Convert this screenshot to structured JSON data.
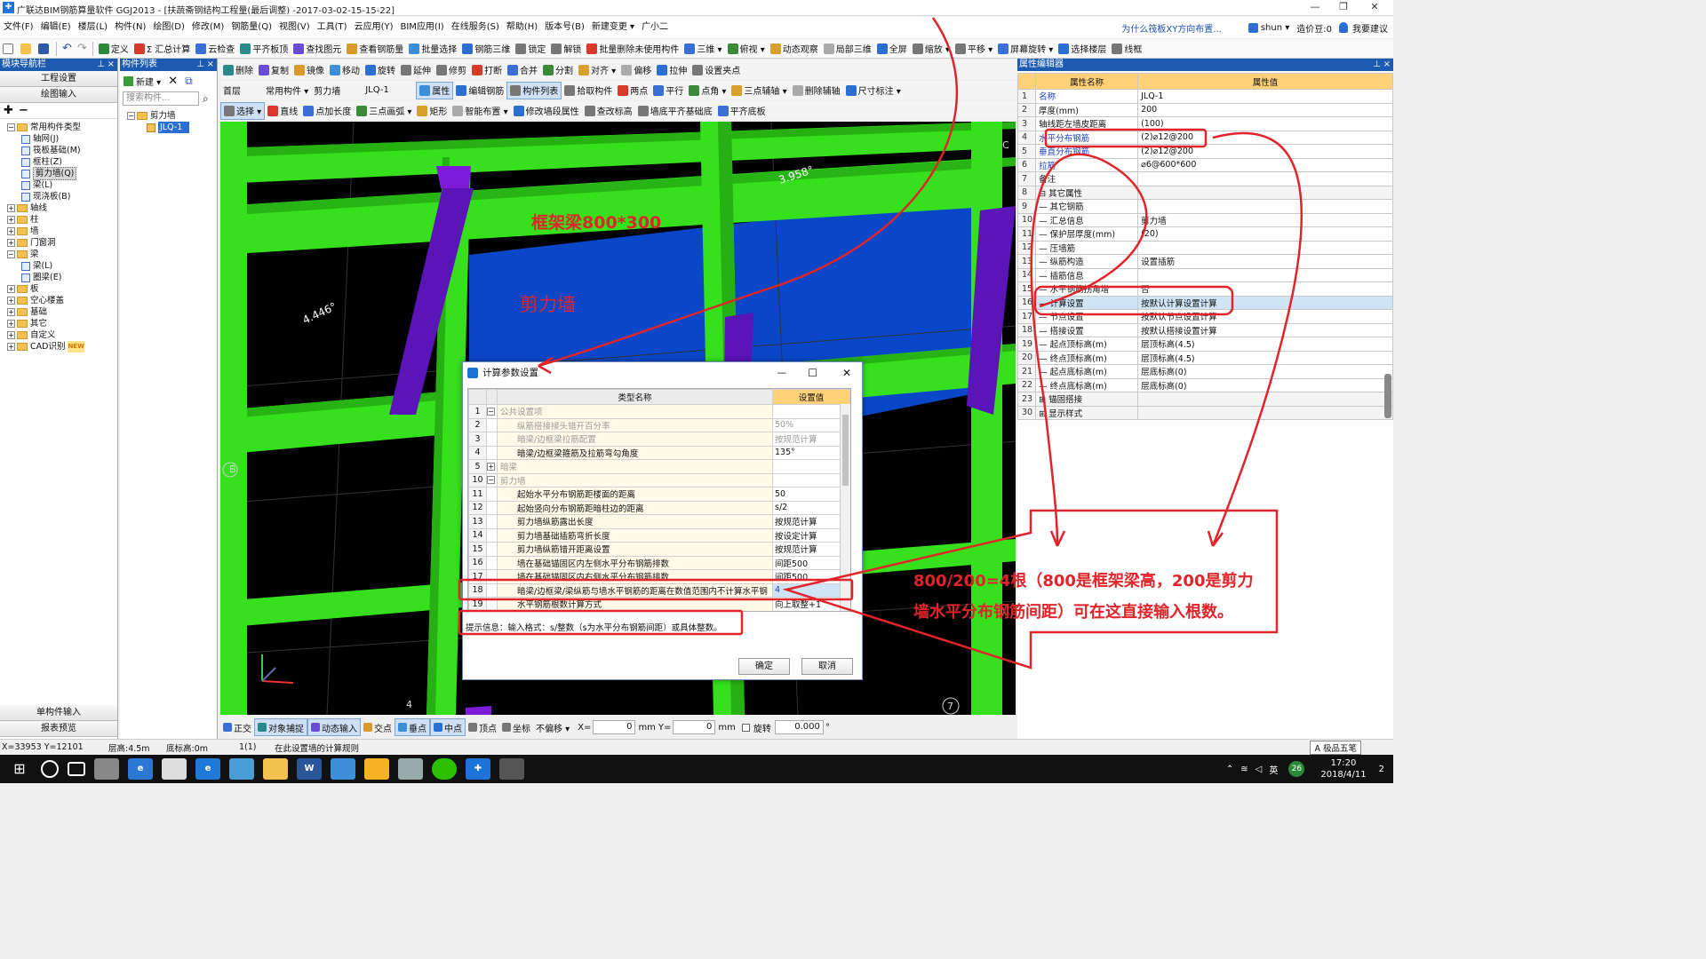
{
  "titlebar": {
    "title": "广联达BIM钢筋算量软件 GGJ2013 - [扶蔬斋钢结构工程量(最后调整) -2017-03-02-15-15-22]",
    "minimize": "—",
    "restore": "❐",
    "close": "✕"
  },
  "menu": {
    "items": [
      "文件(F)",
      "编辑(E)",
      "楼层(L)",
      "构件(N)",
      "绘图(D)",
      "修改(M)",
      "钢筋量(Q)",
      "视图(V)",
      "工具(T)",
      "云应用(Y)",
      "BIM应用(I)",
      "在线服务(S)",
      "帮助(H)",
      "版本号(B)",
      "新建变更 ▾",
      "广小二"
    ],
    "right_link": "为什么筏板XY方向布置...",
    "user": "shun ▾",
    "cost": "造价豆:0",
    "wish": "我要建议"
  },
  "toolbar1": {
    "items": [
      "定义",
      "Σ 汇总计算",
      "云检查",
      "平齐板顶",
      "查找图元",
      "查看钢筋量",
      "批量选择",
      "钢筋三维",
      "锁定",
      "解锁",
      "批量删除未使用构件",
      "三维 ▾",
      "俯视 ▾",
      "动态观察",
      "局部三维",
      "全屏",
      "缩放 ▾",
      "平移 ▾",
      "屏幕旋转 ▾",
      "选择楼层",
      "线框"
    ]
  },
  "toolbar2": {
    "items": [
      "删除",
      "复制",
      "镜像",
      "移动",
      "旋转",
      "延伸",
      "修剪",
      "打断",
      "合并",
      "分割",
      "对齐 ▾",
      "偏移",
      "拉伸",
      "设置夹点"
    ]
  },
  "toolbar3": {
    "floor": "首层",
    "category": "常用构件 ▾",
    "type": "剪力墙",
    "element": "JLQ-1",
    "items": [
      "属性",
      "编辑钢筋",
      "构件列表",
      "拾取构件",
      "两点",
      "平行",
      "点角 ▾",
      "三点辅轴 ▾",
      "删除辅轴",
      "尺寸标注 ▾"
    ]
  },
  "toolbar4": {
    "items": [
      "选择 ▾",
      "直线",
      "点加长度",
      "三点画弧 ▾",
      "矩形",
      "智能布置 ▾",
      "修改墙段属性",
      "查改标高",
      "墙底平齐基础底",
      "平齐底板"
    ]
  },
  "nav": {
    "title": "模块导航栏",
    "btn1": "工程设置",
    "btn2": "绘图输入",
    "tree": [
      {
        "level": 0,
        "exp": "−",
        "label": "常用构件类型",
        "icon": "folder"
      },
      {
        "level": 1,
        "label": "轴网(J)",
        "icon": "comp"
      },
      {
        "level": 1,
        "label": "筏板基础(M)",
        "icon": "comp"
      },
      {
        "level": 1,
        "label": "框柱(Z)",
        "icon": "comp"
      },
      {
        "level": 1,
        "label": "剪力墙(Q)",
        "icon": "comp",
        "selected": true
      },
      {
        "level": 1,
        "label": "梁(L)",
        "icon": "comp"
      },
      {
        "level": 1,
        "label": "现浇板(B)",
        "icon": "comp"
      },
      {
        "level": 0,
        "exp": "+",
        "label": "轴线",
        "icon": "folder"
      },
      {
        "level": 0,
        "exp": "+",
        "label": "柱",
        "icon": "folder"
      },
      {
        "level": 0,
        "exp": "+",
        "label": "墙",
        "icon": "folder"
      },
      {
        "level": 0,
        "exp": "+",
        "label": "门窗洞",
        "icon": "folder"
      },
      {
        "level": 0,
        "exp": "−",
        "label": "梁",
        "icon": "folder"
      },
      {
        "level": 1,
        "label": "梁(L)",
        "icon": "comp"
      },
      {
        "level": 1,
        "label": "圈梁(E)",
        "icon": "comp"
      },
      {
        "level": 0,
        "exp": "+",
        "label": "板",
        "icon": "folder"
      },
      {
        "level": 0,
        "exp": "+",
        "label": "空心楼盖",
        "icon": "folder"
      },
      {
        "level": 0,
        "exp": "+",
        "label": "基础",
        "icon": "folder"
      },
      {
        "level": 0,
        "exp": "+",
        "label": "其它",
        "icon": "folder"
      },
      {
        "level": 0,
        "exp": "+",
        "label": "自定义",
        "icon": "folder"
      },
      {
        "level": 0,
        "exp": "+",
        "label": "CAD识别",
        "icon": "folder",
        "badge": "NEW"
      }
    ],
    "bottom1": "单构件输入",
    "bottom2": "报表预览"
  },
  "complist": {
    "title": "构件列表",
    "new_btn": "新建 ▾",
    "search_placeholder": "搜索构件...",
    "group": "剪力墙",
    "item": "JLQ-1"
  },
  "viewport": {
    "angle1": "3.958°",
    "angle2": "4.446°",
    "axis_b1": "B",
    "axis_b2": "B",
    "axis_4": "4",
    "axis_7": "7",
    "axis_c": "C"
  },
  "props": {
    "title": "属性编辑器",
    "col_name": "属性名称",
    "col_value": "属性值",
    "rows": [
      {
        "n": "1",
        "name": "名称",
        "value": "JLQ-1",
        "blue": true
      },
      {
        "n": "2",
        "name": "厚度(mm)",
        "value": "200",
        "blue": false
      },
      {
        "n": "3",
        "name": "轴线距左墙皮距离",
        "value": "(100)",
        "blue": false
      },
      {
        "n": "4",
        "name": "水平分布钢筋",
        "value": "(2)⌀12@200",
        "blue": true
      },
      {
        "n": "5",
        "name": "垂直分布钢筋",
        "value": "(2)⌀12@200",
        "blue": true
      },
      {
        "n": "6",
        "name": "拉筋",
        "value": "⌀6@600*600",
        "blue": true
      },
      {
        "n": "7",
        "name": "备注",
        "value": "",
        "blue": false
      },
      {
        "n": "8",
        "name": "⊟ 其它属性",
        "value": "",
        "blue": false,
        "group": true
      },
      {
        "n": "9",
        "name": "— 其它钢筋",
        "value": "",
        "blue": false
      },
      {
        "n": "10",
        "name": "— 汇总信息",
        "value": "剪力墙",
        "blue": false
      },
      {
        "n": "11",
        "name": "— 保护层厚度(mm)",
        "value": "(20)",
        "blue": false
      },
      {
        "n": "12",
        "name": "— 压墙筋",
        "value": "",
        "blue": false
      },
      {
        "n": "13",
        "name": "— 纵筋构造",
        "value": "设置插筋",
        "blue": false
      },
      {
        "n": "14",
        "name": "— 插筋信息",
        "value": "",
        "blue": false
      },
      {
        "n": "15",
        "name": "— 水平钢筋拐角增",
        "value": "否",
        "blue": false
      },
      {
        "n": "16",
        "name": "— 计算设置",
        "value": "按默认计算设置计算",
        "blue": false,
        "sel": true
      },
      {
        "n": "17",
        "name": "— 节点设置",
        "value": "按默认节点设置计算",
        "blue": false
      },
      {
        "n": "18",
        "name": "— 搭接设置",
        "value": "按默认搭接设置计算",
        "blue": false
      },
      {
        "n": "19",
        "name": "— 起点顶标高(m)",
        "value": "层顶标高(4.5)",
        "blue": false
      },
      {
        "n": "20",
        "name": "— 终点顶标高(m)",
        "value": "层顶标高(4.5)",
        "blue": false
      },
      {
        "n": "21",
        "name": "— 起点底标高(m)",
        "value": "层底标高(0)",
        "blue": false
      },
      {
        "n": "22",
        "name": "— 终点底标高(m)",
        "value": "层底标高(0)",
        "blue": false
      },
      {
        "n": "23",
        "name": "⊞ 锚固搭接",
        "value": "",
        "blue": false,
        "group": true
      },
      {
        "n": "30",
        "name": "⊞ 显示样式",
        "value": "",
        "blue": false,
        "group": true
      }
    ]
  },
  "dialog": {
    "title": "计算参数设置",
    "col_type": "类型名称",
    "col_value": "设置值",
    "rows": [
      {
        "n": "1",
        "e": "−",
        "name": "公共设置项",
        "value": "",
        "grey": true,
        "indent": 0
      },
      {
        "n": "2",
        "e": "",
        "name": "纵筋搭接接头错开百分率",
        "value": "50%",
        "grey": true,
        "indent": 1
      },
      {
        "n": "3",
        "e": "",
        "name": "暗梁/边框梁拉筋配置",
        "value": "按规范计算",
        "grey": true,
        "indent": 1
      },
      {
        "n": "4",
        "e": "",
        "name": "暗梁/边框梁箍筋及拉筋弯勾角度",
        "value": "135°",
        "grey": false,
        "indent": 1
      },
      {
        "n": "5",
        "e": "+",
        "name": "暗梁",
        "value": "",
        "grey": true,
        "indent": 0
      },
      {
        "n": "10",
        "e": "−",
        "name": "剪力墙",
        "value": "",
        "grey": true,
        "indent": 0
      },
      {
        "n": "11",
        "e": "",
        "name": "起始水平分布钢筋距楼面的距离",
        "value": "50",
        "grey": false,
        "indent": 1
      },
      {
        "n": "12",
        "e": "",
        "name": "起始竖向分布钢筋距暗柱边的距离",
        "value": "s/2",
        "grey": false,
        "indent": 1
      },
      {
        "n": "13",
        "e": "",
        "name": "剪力墙纵筋露出长度",
        "value": "按规范计算",
        "grey": false,
        "indent": 1
      },
      {
        "n": "14",
        "e": "",
        "name": "剪力墙基础插筋弯折长度",
        "value": "按设定计算",
        "grey": false,
        "indent": 1
      },
      {
        "n": "15",
        "e": "",
        "name": "剪力墙纵筋错开距离设置",
        "value": "按规范计算",
        "grey": false,
        "indent": 1
      },
      {
        "n": "16",
        "e": "",
        "name": "墙在基础锚固区内左侧水平分布钢筋排数",
        "value": "间距500",
        "grey": false,
        "indent": 1
      },
      {
        "n": "17",
        "e": "",
        "name": "墙在基础锚固区内右侧水平分布钢筋排数",
        "value": "间距500",
        "grey": false,
        "indent": 1
      },
      {
        "n": "18",
        "e": "",
        "name": "暗梁/边框梁/梁纵筋与墙水平钢筋的距离在数值范围内不计算水平钢",
        "value": "4",
        "grey": false,
        "indent": 1,
        "sel": true
      },
      {
        "n": "19",
        "e": "",
        "name": "水平钢筋根数计算方式",
        "value": "向上取整+1",
        "grey": false,
        "indent": 1
      }
    ],
    "hint": "提示信息：输入格式：s/整数（s为水平分布钢筋间距）或具体整数。",
    "ok": "确定",
    "cancel": "取消"
  },
  "statusbar": {
    "items": [
      "正交",
      "对象捕捉",
      "动态输入",
      "交点",
      "垂点",
      "中点",
      "顶点",
      "坐标",
      "不偏移 ▾"
    ],
    "x_label": "X=",
    "x_val": "0",
    "mm": "mm",
    "y_label": "Y=",
    "y_val": "0",
    "rotate_label": "旋转",
    "rotate_val": "0.000",
    "deg": "°"
  },
  "statusbar2": {
    "coords": "X=33953 Y=12101",
    "floor_height": "层高:4.5m",
    "base": "底标高:0m",
    "count": "1(1)",
    "hint": "在此设置墙的计算规则",
    "ime": "A 极品五笔"
  },
  "annotations": {
    "beam": "框架梁800*300",
    "wall": "剪力墙",
    "note_line1": "800/200=4根（800是框架梁高，200是剪力",
    "note_line2": "墙水平分布钢筋间距）可在这直接输入根数。"
  },
  "taskbar": {
    "time": "17:20",
    "date": "2018/4/11",
    "lang": "英",
    "notif": "2",
    "badge": "26"
  }
}
